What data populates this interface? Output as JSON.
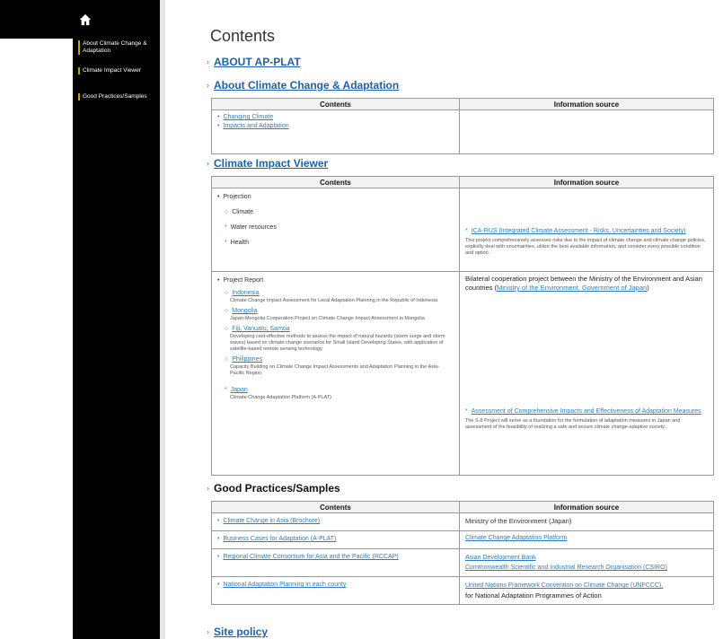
{
  "sidebar": {
    "home_icon": "home-icon",
    "items": [
      {
        "label": "About Climate Change & Adaptation"
      },
      {
        "label": "Climate Impact Viewer"
      },
      {
        "label": "Good Practices/Samples"
      }
    ]
  },
  "page": {
    "title": "Contents"
  },
  "sections": {
    "about_ap_plat": "ABOUT AP-PLAT",
    "about_cc": "About Climate Change & Adaptation",
    "viewer": "Climate Impact Viewer",
    "good": "Good Practices/Samples",
    "site_policy": "Site policy"
  },
  "table_headers": {
    "contents": "Contents",
    "source": "Information source"
  },
  "about_cc_table": {
    "items": [
      "Changing Climate",
      "Impacts and Adaptation"
    ]
  },
  "viewer_table": {
    "projection": "Projection",
    "projection_items": [
      "Climate",
      "Water resources",
      "Health"
    ],
    "ica_link": "ICA-RUS (Integrated Climate Assessment - Risks, Uncertainties and Society)",
    "ica_desc": "This project comprehensively assesses risks due to the impact of climate change and climate change policies, explicitly deal with uncertainties, utilize the best available information, and consider every possible condition and option.",
    "project_report": "Project Report",
    "countries": [
      {
        "name": "Indonesia",
        "desc": "Climate Change Impact Assessment for Local Adaptation Planning in the Republic of Indonesia"
      },
      {
        "name": "Mongolia",
        "desc": "Japan-Mongolia Cooperation Project on Climate Change Impact Assessment in Mongolia"
      },
      {
        "name": "Fiji, Vanuatu, Samoa",
        "desc": "Developing cost-effective methods to assess the impact of natural hazards (storm surge and storm waves) based on climate change scenarios for Small Island Developing States, with application of satellite-based remote sensing technology"
      },
      {
        "name": "Philippines",
        "desc": "Capacity Building on Climate Change Impact Assessments and Adaptation Planning in the Asia-Pacific Region"
      },
      {
        "name": "Japan",
        "desc": "Climate Change Adaptation Platform (A-PLAT)"
      }
    ],
    "bilateral_text": "Bilateral cooperation project between the Ministry of the Environment and Asian countries (",
    "bilateral_link": "Ministry of the Environment, Government of Japan",
    "bilateral_close": ")",
    "assessment_link": "Assessment of Comprehensive Impacts and Effectiveness of Adaptation Measures",
    "assessment_desc": "The S-8 Project will serve as a foundation for the formulation of adaptation measures in Japan and assessment of the feasibility of realizing a safe and secure climate change-adaptive society."
  },
  "good_table": {
    "rows": [
      {
        "content": "Climate Change in Asia (Brochure)",
        "source": "Ministry of the Environment (Japan)"
      },
      {
        "content": "Business Cases for Adaptation (A-PLAT)",
        "source": "Climate Change Adaptation Platform"
      },
      {
        "content": "Regional Climate Consortium for Asia and the Pacific (RCCAP)",
        "source1": "Asian Development Bank",
        "source2": "Commonwealth Scientific and Industrial Research Organisation (CSIRO)"
      },
      {
        "content": "National Adaptation Planning in each county",
        "source_link": "United Nations Framework Convention on Climate Change (UNFCCC),",
        "source_text": "for National Adaptation Programmes of Action"
      }
    ]
  }
}
